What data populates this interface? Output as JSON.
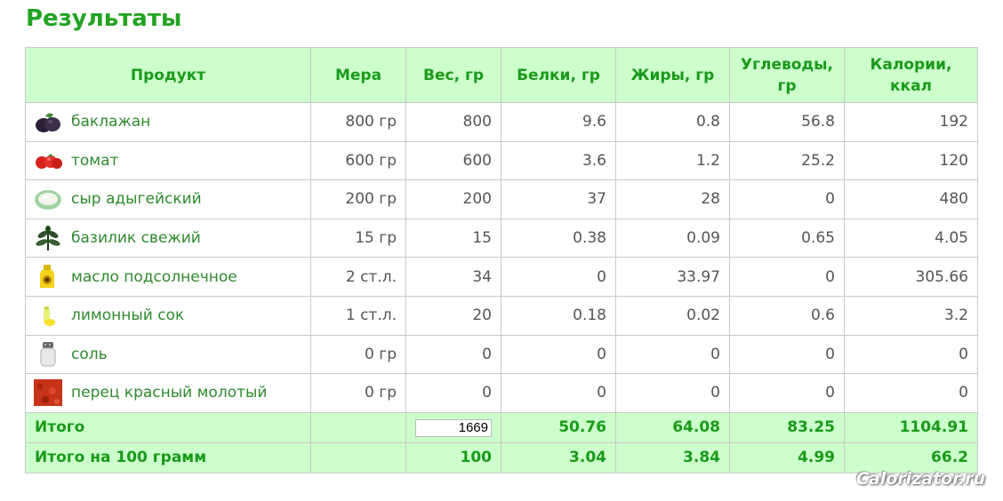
{
  "title": "Результаты",
  "columns": [
    "Продукт",
    "Мера",
    "Вес, гр",
    "Белки, гр",
    "Жиры, гр",
    "Углеводы, гр",
    "Калории, ккал"
  ],
  "rows": [
    {
      "icon": "eggplant-icon",
      "product": "баклажан",
      "measure": "800 гр",
      "weight": "800",
      "protein": "9.6",
      "fat": "0.8",
      "carbs": "56.8",
      "calories": "192"
    },
    {
      "icon": "tomato-icon",
      "product": "томат",
      "measure": "600 гр",
      "weight": "600",
      "protein": "3.6",
      "fat": "1.2",
      "carbs": "25.2",
      "calories": "120"
    },
    {
      "icon": "cheese-icon",
      "product": "сыр адыгейский",
      "measure": "200 гр",
      "weight": "200",
      "protein": "37",
      "fat": "28",
      "carbs": "0",
      "calories": "480"
    },
    {
      "icon": "basil-icon",
      "product": "базилик свежий",
      "measure": "15 гр",
      "weight": "15",
      "protein": "0.38",
      "fat": "0.09",
      "carbs": "0.65",
      "calories": "4.05"
    },
    {
      "icon": "sunflower-oil-icon",
      "product": "масло подсолнечное",
      "measure": "2 ст.л.",
      "weight": "34",
      "protein": "0",
      "fat": "33.97",
      "carbs": "0",
      "calories": "305.66"
    },
    {
      "icon": "lemon-juice-icon",
      "product": "лимонный сок",
      "measure": "1 ст.л.",
      "weight": "20",
      "protein": "0.18",
      "fat": "0.02",
      "carbs": "0.6",
      "calories": "3.2"
    },
    {
      "icon": "salt-icon",
      "product": "соль",
      "measure": "0 гр",
      "weight": "0",
      "protein": "0",
      "fat": "0",
      "carbs": "0",
      "calories": "0"
    },
    {
      "icon": "red-pepper-icon",
      "product": "перец красный молотый",
      "measure": "0 гр",
      "weight": "0",
      "protein": "0",
      "fat": "0",
      "carbs": "0",
      "calories": "0"
    }
  ],
  "total": {
    "label": "Итого",
    "weight": "1669",
    "protein": "50.76",
    "fat": "64.08",
    "carbs": "83.25",
    "calories": "1104.91"
  },
  "per100": {
    "label": "Итого на 100 грамм",
    "weight": "100",
    "protein": "3.04",
    "fat": "3.84",
    "carbs": "4.99",
    "calories": "66.2"
  },
  "colors": {
    "accent": "#1a9a1a",
    "header_bg": "#ccffcc",
    "product_text": "#2e8b2e",
    "value_text": "#555555"
  },
  "watermark": "Calorizator.ru"
}
